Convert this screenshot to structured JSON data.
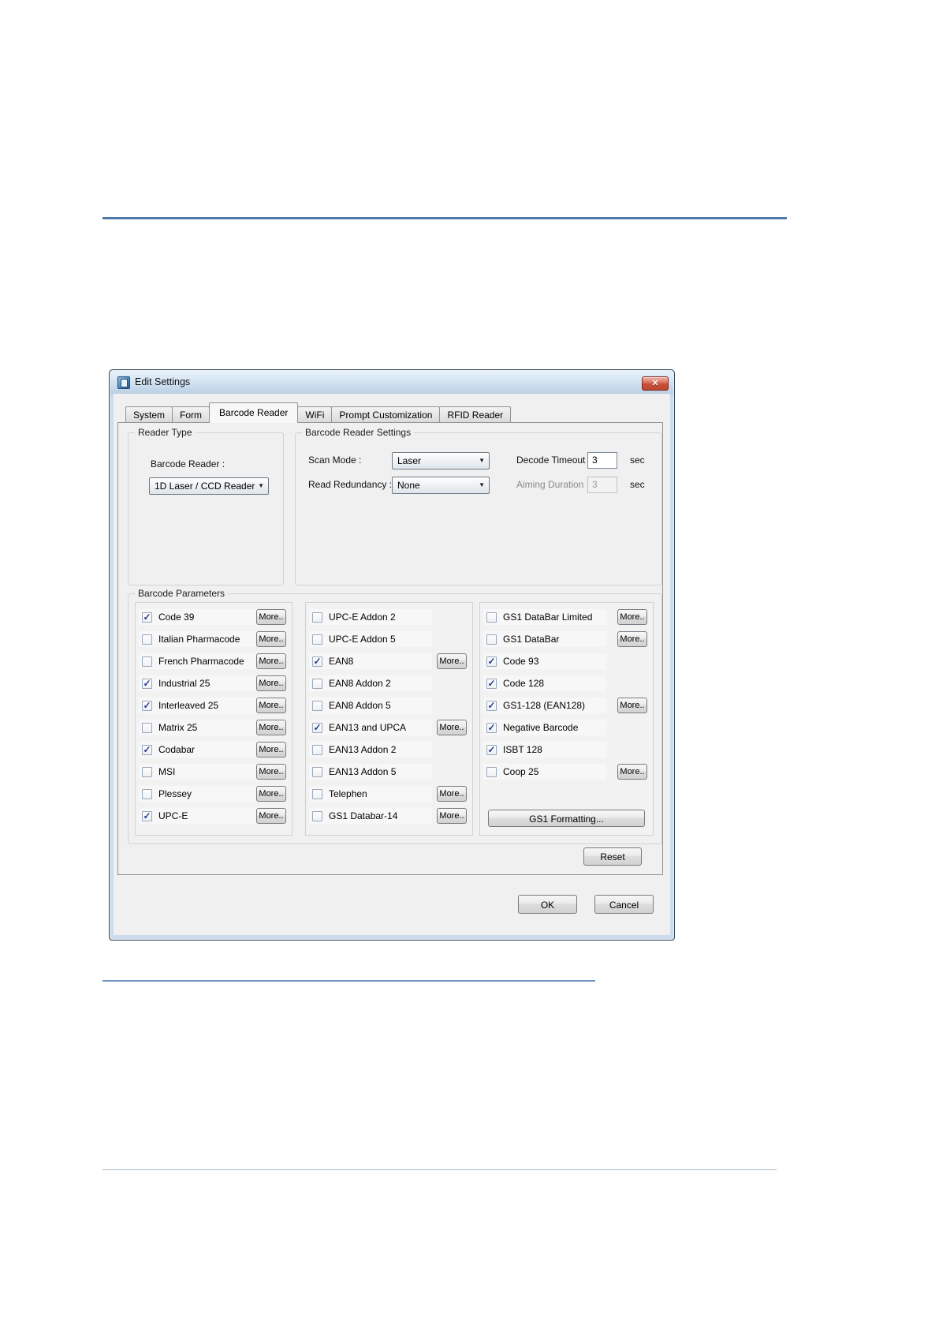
{
  "window": {
    "title": "Edit Settings",
    "icons": {
      "close": "✕",
      "check": "✓",
      "dropdown_arrow": "▼"
    }
  },
  "tabs": [
    {
      "label": "System",
      "active": false
    },
    {
      "label": "Form",
      "active": false
    },
    {
      "label": "Barcode Reader",
      "active": true
    },
    {
      "label": "WiFi",
      "active": false
    },
    {
      "label": "Prompt Customization",
      "active": false
    },
    {
      "label": "RFID Reader",
      "active": false
    }
  ],
  "reader_type": {
    "legend": "Reader Type",
    "field_label": "Barcode Reader :",
    "field_value": "1D Laser / CCD Reader"
  },
  "reader_settings": {
    "legend": "Barcode Reader Settings",
    "scan_mode": {
      "label": "Scan Mode :",
      "value": "Laser"
    },
    "read_redundancy": {
      "label": "Read Redundancy :",
      "value": "None"
    },
    "decode_timeout": {
      "label": "Decode Timeout :",
      "value": "3",
      "unit": "sec",
      "enabled": true
    },
    "aiming_duration": {
      "label": "Aiming Duration :",
      "value": "3",
      "unit": "sec",
      "enabled": false
    }
  },
  "barcode_parameters": {
    "legend": "Barcode Parameters",
    "more_label": "More..",
    "columns": [
      [
        {
          "label": "Code 39",
          "checked": true,
          "more": true
        },
        {
          "label": "Italian Pharmacode",
          "checked": false,
          "more": true
        },
        {
          "label": "French Pharmacode",
          "checked": false,
          "more": true
        },
        {
          "label": "Industrial 25",
          "checked": true,
          "more": true
        },
        {
          "label": "Interleaved 25",
          "checked": true,
          "more": true
        },
        {
          "label": "Matrix 25",
          "checked": false,
          "more": true
        },
        {
          "label": "Codabar",
          "checked": true,
          "more": true
        },
        {
          "label": "MSI",
          "checked": false,
          "more": true
        },
        {
          "label": "Plessey",
          "checked": false,
          "more": true
        },
        {
          "label": "UPC-E",
          "checked": true,
          "more": true
        }
      ],
      [
        {
          "label": "UPC-E Addon 2",
          "checked": false,
          "more": false
        },
        {
          "label": "UPC-E Addon 5",
          "checked": false,
          "more": false
        },
        {
          "label": "EAN8",
          "checked": true,
          "more": true
        },
        {
          "label": "EAN8 Addon 2",
          "checked": false,
          "more": false
        },
        {
          "label": "EAN8 Addon 5",
          "checked": false,
          "more": false
        },
        {
          "label": "EAN13 and UPCA",
          "checked": true,
          "more": true
        },
        {
          "label": "EAN13 Addon 2",
          "checked": false,
          "more": false
        },
        {
          "label": "EAN13 Addon 5",
          "checked": false,
          "more": false
        },
        {
          "label": "Telephen",
          "checked": false,
          "more": true
        },
        {
          "label": "GS1 Databar-14",
          "checked": false,
          "more": true
        }
      ],
      [
        {
          "label": "GS1 DataBar Limited",
          "checked": false,
          "more": true
        },
        {
          "label": "GS1 DataBar",
          "checked": false,
          "more": true
        },
        {
          "label": "Code 93",
          "checked": true,
          "more": false
        },
        {
          "label": "Code 128",
          "checked": true,
          "more": false
        },
        {
          "label": "GS1-128 (EAN128)",
          "checked": true,
          "more": true
        },
        {
          "label": "Negative Barcode",
          "checked": true,
          "more": false
        },
        {
          "label": "ISBT 128",
          "checked": true,
          "more": false
        },
        {
          "label": "Coop 25",
          "checked": false,
          "more": true
        }
      ]
    ],
    "gs1_formatting_label": "GS1 Formatting...",
    "reset_label": "Reset"
  },
  "actions": {
    "ok": "OK",
    "cancel": "Cancel"
  }
}
